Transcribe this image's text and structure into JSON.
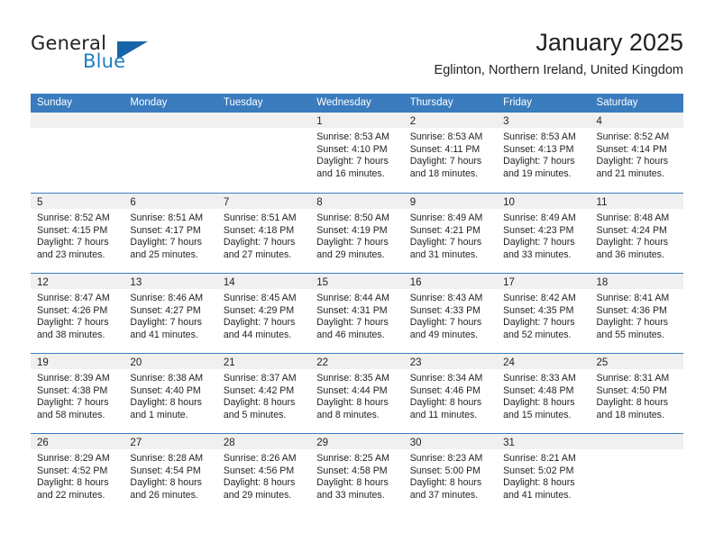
{
  "brand": {
    "name_part1": "General",
    "name_part2": "Blue",
    "logo_icon": "triangle-logo-icon"
  },
  "header": {
    "month_title": "January 2025",
    "location": "Eglinton, Northern Ireland, United Kingdom"
  },
  "colors": {
    "header_band": "#3a7cbe",
    "daynum_band": "#f0f0f0",
    "brand_blue": "#1c7fc4",
    "text": "#231f20"
  },
  "calendar": {
    "weekday_headers": [
      "Sunday",
      "Monday",
      "Tuesday",
      "Wednesday",
      "Thursday",
      "Friday",
      "Saturday"
    ],
    "weeks": [
      [
        {
          "day": "",
          "empty": true,
          "lines": []
        },
        {
          "day": "",
          "empty": true,
          "lines": []
        },
        {
          "day": "",
          "empty": true,
          "lines": []
        },
        {
          "day": "1",
          "empty": false,
          "lines": [
            "Sunrise: 8:53 AM",
            "Sunset: 4:10 PM",
            "Daylight: 7 hours",
            "and 16 minutes."
          ]
        },
        {
          "day": "2",
          "empty": false,
          "lines": [
            "Sunrise: 8:53 AM",
            "Sunset: 4:11 PM",
            "Daylight: 7 hours",
            "and 18 minutes."
          ]
        },
        {
          "day": "3",
          "empty": false,
          "lines": [
            "Sunrise: 8:53 AM",
            "Sunset: 4:13 PM",
            "Daylight: 7 hours",
            "and 19 minutes."
          ]
        },
        {
          "day": "4",
          "empty": false,
          "lines": [
            "Sunrise: 8:52 AM",
            "Sunset: 4:14 PM",
            "Daylight: 7 hours",
            "and 21 minutes."
          ]
        }
      ],
      [
        {
          "day": "5",
          "empty": false,
          "lines": [
            "Sunrise: 8:52 AM",
            "Sunset: 4:15 PM",
            "Daylight: 7 hours",
            "and 23 minutes."
          ]
        },
        {
          "day": "6",
          "empty": false,
          "lines": [
            "Sunrise: 8:51 AM",
            "Sunset: 4:17 PM",
            "Daylight: 7 hours",
            "and 25 minutes."
          ]
        },
        {
          "day": "7",
          "empty": false,
          "lines": [
            "Sunrise: 8:51 AM",
            "Sunset: 4:18 PM",
            "Daylight: 7 hours",
            "and 27 minutes."
          ]
        },
        {
          "day": "8",
          "empty": false,
          "lines": [
            "Sunrise: 8:50 AM",
            "Sunset: 4:19 PM",
            "Daylight: 7 hours",
            "and 29 minutes."
          ]
        },
        {
          "day": "9",
          "empty": false,
          "lines": [
            "Sunrise: 8:49 AM",
            "Sunset: 4:21 PM",
            "Daylight: 7 hours",
            "and 31 minutes."
          ]
        },
        {
          "day": "10",
          "empty": false,
          "lines": [
            "Sunrise: 8:49 AM",
            "Sunset: 4:23 PM",
            "Daylight: 7 hours",
            "and 33 minutes."
          ]
        },
        {
          "day": "11",
          "empty": false,
          "lines": [
            "Sunrise: 8:48 AM",
            "Sunset: 4:24 PM",
            "Daylight: 7 hours",
            "and 36 minutes."
          ]
        }
      ],
      [
        {
          "day": "12",
          "empty": false,
          "lines": [
            "Sunrise: 8:47 AM",
            "Sunset: 4:26 PM",
            "Daylight: 7 hours",
            "and 38 minutes."
          ]
        },
        {
          "day": "13",
          "empty": false,
          "lines": [
            "Sunrise: 8:46 AM",
            "Sunset: 4:27 PM",
            "Daylight: 7 hours",
            "and 41 minutes."
          ]
        },
        {
          "day": "14",
          "empty": false,
          "lines": [
            "Sunrise: 8:45 AM",
            "Sunset: 4:29 PM",
            "Daylight: 7 hours",
            "and 44 minutes."
          ]
        },
        {
          "day": "15",
          "empty": false,
          "lines": [
            "Sunrise: 8:44 AM",
            "Sunset: 4:31 PM",
            "Daylight: 7 hours",
            "and 46 minutes."
          ]
        },
        {
          "day": "16",
          "empty": false,
          "lines": [
            "Sunrise: 8:43 AM",
            "Sunset: 4:33 PM",
            "Daylight: 7 hours",
            "and 49 minutes."
          ]
        },
        {
          "day": "17",
          "empty": false,
          "lines": [
            "Sunrise: 8:42 AM",
            "Sunset: 4:35 PM",
            "Daylight: 7 hours",
            "and 52 minutes."
          ]
        },
        {
          "day": "18",
          "empty": false,
          "lines": [
            "Sunrise: 8:41 AM",
            "Sunset: 4:36 PM",
            "Daylight: 7 hours",
            "and 55 minutes."
          ]
        }
      ],
      [
        {
          "day": "19",
          "empty": false,
          "lines": [
            "Sunrise: 8:39 AM",
            "Sunset: 4:38 PM",
            "Daylight: 7 hours",
            "and 58 minutes."
          ]
        },
        {
          "day": "20",
          "empty": false,
          "lines": [
            "Sunrise: 8:38 AM",
            "Sunset: 4:40 PM",
            "Daylight: 8 hours",
            "and 1 minute."
          ]
        },
        {
          "day": "21",
          "empty": false,
          "lines": [
            "Sunrise: 8:37 AM",
            "Sunset: 4:42 PM",
            "Daylight: 8 hours",
            "and 5 minutes."
          ]
        },
        {
          "day": "22",
          "empty": false,
          "lines": [
            "Sunrise: 8:35 AM",
            "Sunset: 4:44 PM",
            "Daylight: 8 hours",
            "and 8 minutes."
          ]
        },
        {
          "day": "23",
          "empty": false,
          "lines": [
            "Sunrise: 8:34 AM",
            "Sunset: 4:46 PM",
            "Daylight: 8 hours",
            "and 11 minutes."
          ]
        },
        {
          "day": "24",
          "empty": false,
          "lines": [
            "Sunrise: 8:33 AM",
            "Sunset: 4:48 PM",
            "Daylight: 8 hours",
            "and 15 minutes."
          ]
        },
        {
          "day": "25",
          "empty": false,
          "lines": [
            "Sunrise: 8:31 AM",
            "Sunset: 4:50 PM",
            "Daylight: 8 hours",
            "and 18 minutes."
          ]
        }
      ],
      [
        {
          "day": "26",
          "empty": false,
          "lines": [
            "Sunrise: 8:29 AM",
            "Sunset: 4:52 PM",
            "Daylight: 8 hours",
            "and 22 minutes."
          ]
        },
        {
          "day": "27",
          "empty": false,
          "lines": [
            "Sunrise: 8:28 AM",
            "Sunset: 4:54 PM",
            "Daylight: 8 hours",
            "and 26 minutes."
          ]
        },
        {
          "day": "28",
          "empty": false,
          "lines": [
            "Sunrise: 8:26 AM",
            "Sunset: 4:56 PM",
            "Daylight: 8 hours",
            "and 29 minutes."
          ]
        },
        {
          "day": "29",
          "empty": false,
          "lines": [
            "Sunrise: 8:25 AM",
            "Sunset: 4:58 PM",
            "Daylight: 8 hours",
            "and 33 minutes."
          ]
        },
        {
          "day": "30",
          "empty": false,
          "lines": [
            "Sunrise: 8:23 AM",
            "Sunset: 5:00 PM",
            "Daylight: 8 hours",
            "and 37 minutes."
          ]
        },
        {
          "day": "31",
          "empty": false,
          "lines": [
            "Sunrise: 8:21 AM",
            "Sunset: 5:02 PM",
            "Daylight: 8 hours",
            "and 41 minutes."
          ]
        },
        {
          "day": "",
          "empty": true,
          "lines": []
        }
      ]
    ]
  }
}
